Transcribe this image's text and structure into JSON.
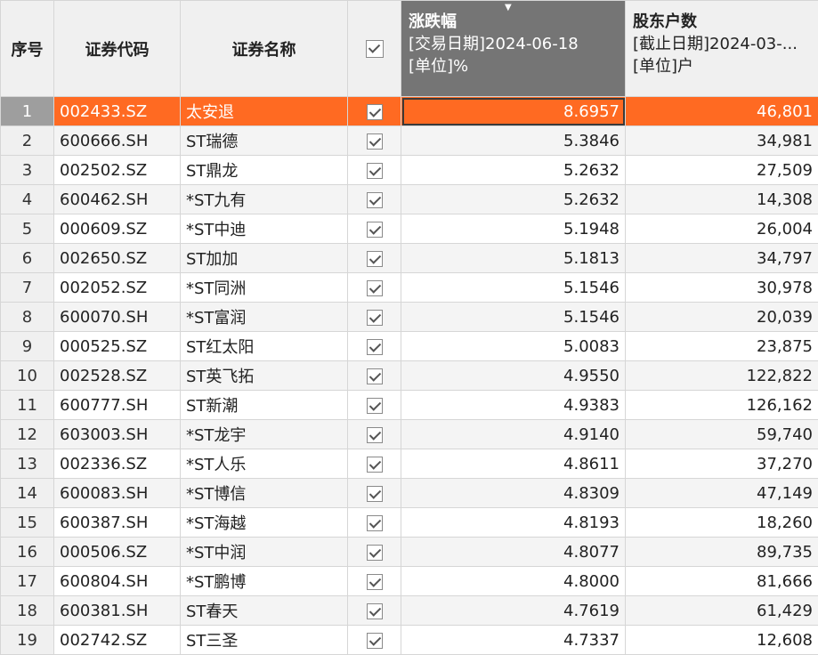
{
  "header": {
    "col_index": "序号",
    "col_code": "证券代码",
    "col_name": "证券名称",
    "col_check_icon": "checkbox-checked",
    "col_change": {
      "title": "涨跌幅",
      "line1": "[交易日期]2024-06-18",
      "line2": "[单位]%"
    },
    "col_holders": {
      "title": "股东户数",
      "line1": "[截止日期]2024-03-...",
      "line2": "[单位]户"
    }
  },
  "colors": {
    "selected_row": "#ff6a22",
    "sorted_header": "#757575",
    "header_bg": "#f0f0f0"
  },
  "rows": [
    {
      "idx": "1",
      "code": "002433.SZ",
      "name": "太安退",
      "change": "8.6957",
      "holders": "46,801"
    },
    {
      "idx": "2",
      "code": "600666.SH",
      "name": "ST瑞德",
      "change": "5.3846",
      "holders": "34,981"
    },
    {
      "idx": "3",
      "code": "002502.SZ",
      "name": "ST鼎龙",
      "change": "5.2632",
      "holders": "27,509"
    },
    {
      "idx": "4",
      "code": "600462.SH",
      "name": "*ST九有",
      "change": "5.2632",
      "holders": "14,308"
    },
    {
      "idx": "5",
      "code": "000609.SZ",
      "name": "*ST中迪",
      "change": "5.1948",
      "holders": "26,004"
    },
    {
      "idx": "6",
      "code": "002650.SZ",
      "name": "ST加加",
      "change": "5.1813",
      "holders": "34,797"
    },
    {
      "idx": "7",
      "code": "002052.SZ",
      "name": "*ST同洲",
      "change": "5.1546",
      "holders": "30,978"
    },
    {
      "idx": "8",
      "code": "600070.SH",
      "name": "*ST富润",
      "change": "5.1546",
      "holders": "20,039"
    },
    {
      "idx": "9",
      "code": "000525.SZ",
      "name": "ST红太阳",
      "change": "5.0083",
      "holders": "23,875"
    },
    {
      "idx": "10",
      "code": "002528.SZ",
      "name": "ST英飞拓",
      "change": "4.9550",
      "holders": "122,822"
    },
    {
      "idx": "11",
      "code": "600777.SH",
      "name": "ST新潮",
      "change": "4.9383",
      "holders": "126,162"
    },
    {
      "idx": "12",
      "code": "603003.SH",
      "name": "*ST龙宇",
      "change": "4.9140",
      "holders": "59,740"
    },
    {
      "idx": "13",
      "code": "002336.SZ",
      "name": "*ST人乐",
      "change": "4.8611",
      "holders": "37,270"
    },
    {
      "idx": "14",
      "code": "600083.SH",
      "name": "*ST博信",
      "change": "4.8309",
      "holders": "47,149"
    },
    {
      "idx": "15",
      "code": "600387.SH",
      "name": "*ST海越",
      "change": "4.8193",
      "holders": "18,260"
    },
    {
      "idx": "16",
      "code": "000506.SZ",
      "name": "*ST中润",
      "change": "4.8077",
      "holders": "89,735"
    },
    {
      "idx": "17",
      "code": "600804.SH",
      "name": "*ST鹏博",
      "change": "4.8000",
      "holders": "81,666"
    },
    {
      "idx": "18",
      "code": "600381.SH",
      "name": "ST春天",
      "change": "4.7619",
      "holders": "61,429"
    },
    {
      "idx": "19",
      "code": "002742.SZ",
      "name": "ST三圣",
      "change": "4.7337",
      "holders": "12,608"
    }
  ]
}
